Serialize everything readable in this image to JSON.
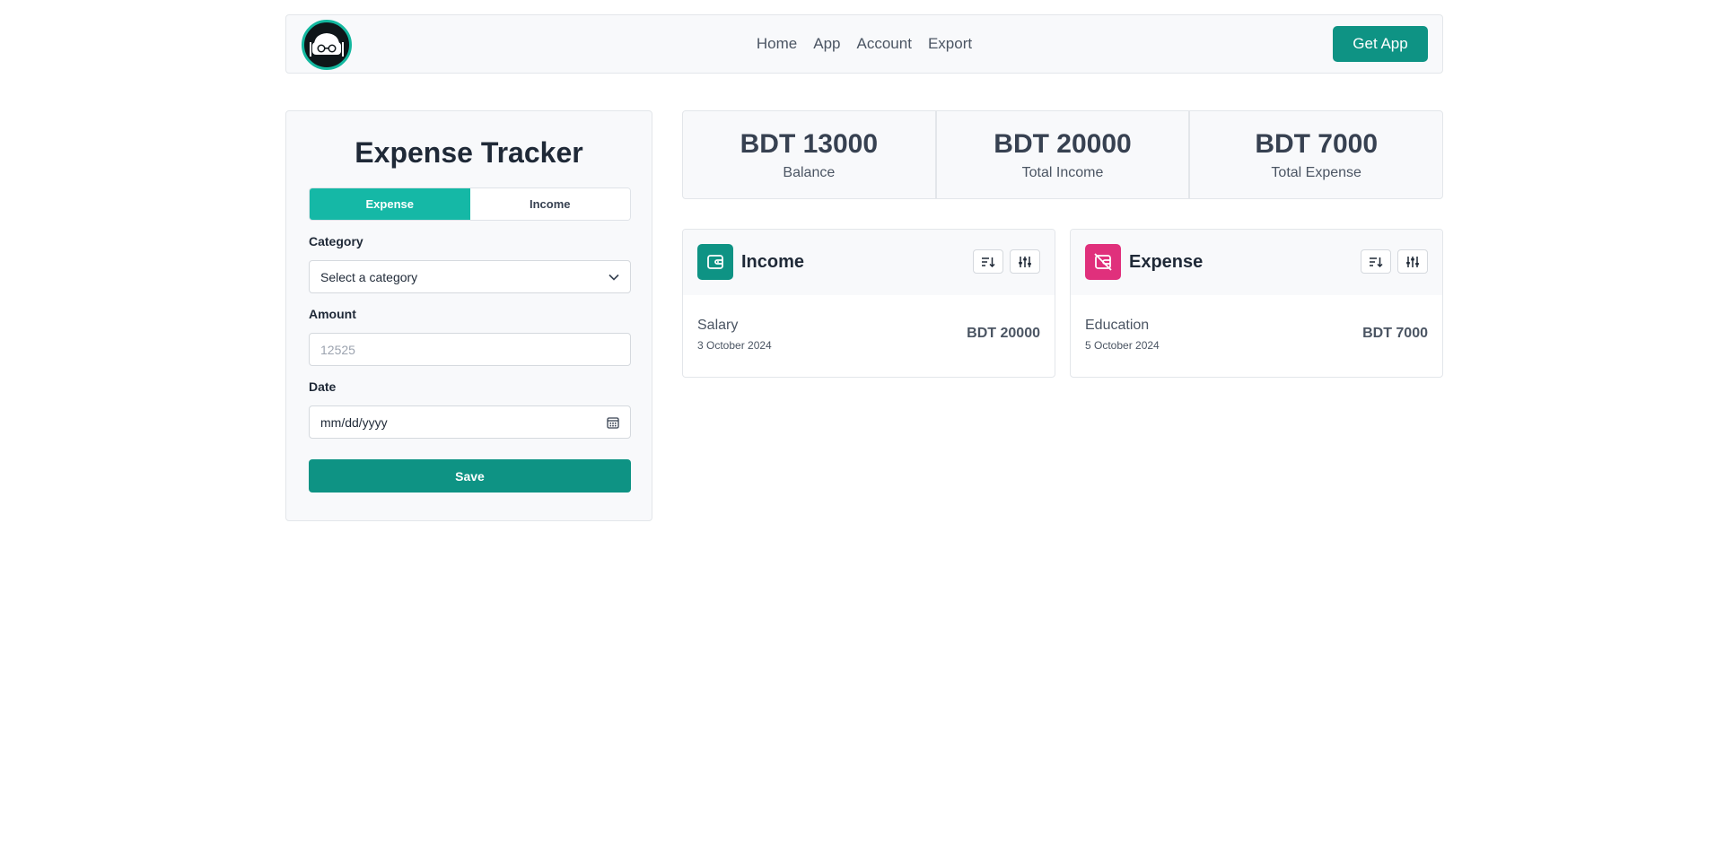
{
  "nav": {
    "links": [
      "Home",
      "App",
      "Account",
      "Export"
    ],
    "cta_label": "Get App"
  },
  "form": {
    "title": "Expense Tracker",
    "tabs": [
      {
        "label": "Expense",
        "active": true
      },
      {
        "label": "Income",
        "active": false
      }
    ],
    "category": {
      "label": "Category",
      "value": "Select a category"
    },
    "amount": {
      "label": "Amount",
      "placeholder": "12525"
    },
    "date": {
      "label": "Date",
      "value": "mm/dd/yyyy"
    },
    "save_label": "Save"
  },
  "summary": [
    {
      "value": "BDT 13000",
      "label": "Balance"
    },
    {
      "value": "BDT 20000",
      "label": "Total Income"
    },
    {
      "value": "BDT 7000",
      "label": "Total Expense"
    }
  ],
  "income": {
    "title": "Income",
    "items": [
      {
        "name": "Salary",
        "date": "3 October 2024",
        "amount": "BDT 20000"
      }
    ]
  },
  "expense": {
    "title": "Expense",
    "items": [
      {
        "name": "Education",
        "date": "5 October 2024",
        "amount": "BDT 7000"
      }
    ]
  },
  "colors": {
    "primary": "#0e9384",
    "tab_active": "#15b8a6",
    "expense_accent": "#e0307c"
  },
  "icons": {
    "logo": "nerd-glasses-logo",
    "income_badge": "wallet-icon",
    "expense_badge": "no-wallet-icon",
    "sort": "sort-icon",
    "filter": "sliders-icon",
    "select": "chevron-down-icon",
    "date": "calendar-icon"
  }
}
